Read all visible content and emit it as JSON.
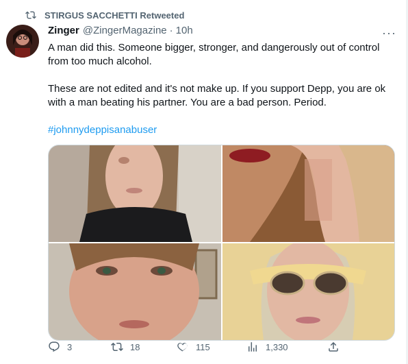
{
  "retweet": {
    "label": "STIRGUS SACCHETTI Retweeted"
  },
  "tweet": {
    "author_name": "Zinger",
    "handle": "@ZingerMagazine",
    "separator": "·",
    "time": "10h",
    "more": "···",
    "paragraph1": "A man did this. Someone bigger, stronger, and dangerously out of control from too much alcohol.",
    "paragraph2": "These are not edited and it's not make up. If you support Depp, you are ok with a man beating his partner. You are a bad person. Period.",
    "hashtag": "#johnnydeppisanabuser"
  },
  "actions": {
    "replies": "3",
    "retweets": "18",
    "likes": "115",
    "views": "1,330"
  },
  "colors": {
    "link": "#1d9bf0",
    "muted": "#536471",
    "text": "#0f1419"
  }
}
